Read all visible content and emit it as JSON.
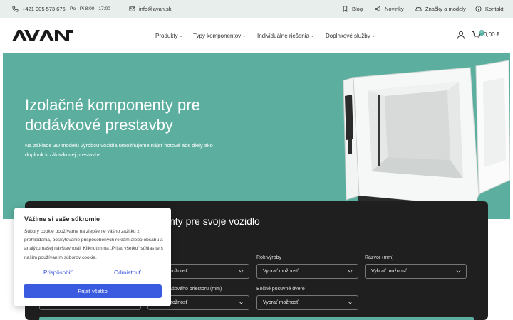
{
  "topbar": {
    "phone": "+421 905 573 676",
    "hours": "Po - Pi 8:00 - 17:00",
    "email": "info@avan.sk",
    "links": [
      "Blog",
      "Novinky",
      "Značky a modely",
      "Kontakt"
    ]
  },
  "header": {
    "logo_text": "AVAN",
    "nav": [
      "Produkty",
      "Typy komponentov",
      "Individuálne riešenia",
      "Doplnkové služby"
    ],
    "cart_count": "0",
    "cart_total": "0,00 €"
  },
  "hero": {
    "title": "Izolačné komponenty pre dodávkové prestavby",
    "subtitle": "Na základe 3D modelu výrobcu vozidla umožňujeme nájsť hotové abs diely ako doplnok k zákazkovej prestavbe."
  },
  "config": {
    "title": "nty pre svoje vozidlo",
    "fields": [
      {
        "label": "",
        "value": "možnosť"
      },
      {
        "label": "Rok výroby",
        "value": "Vybrať možnosť"
      },
      {
        "label": "Rázvor (mm)",
        "value": "Vybrať možnosť"
      },
      {
        "label": "",
        "value": ""
      },
      {
        "label": "adového priestoru (mm)",
        "value": "možnosť"
      },
      {
        "label": "Bočné posuvné dvere",
        "value": "Vybrať možnosť"
      }
    ]
  },
  "cookie": {
    "title": "Vážime si vaše súkromie",
    "text": "Súbory cookie používame na zlepšenie vášho zážitku z prehliadania, poskytovanie prispôsobených reklám alebo obsahu a analýzu našej návštevnosti. Kliknutím na „Prijať všetko“ súhlasíte s naším používaním súborov cookie.",
    "customize": "Prispôsobiť",
    "reject": "Odmietnuť",
    "accept": "Prijať všetko"
  },
  "colors": {
    "accent": "#5caf9f",
    "dark_panel": "#1f1f1f",
    "cookie_button": "#3a5be0"
  }
}
